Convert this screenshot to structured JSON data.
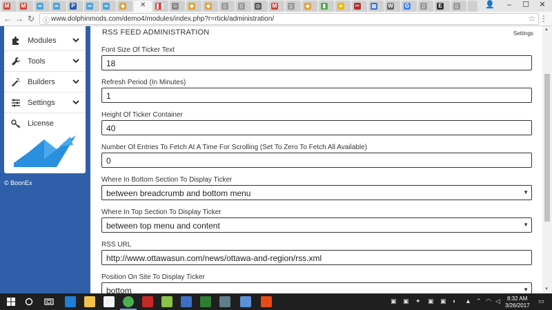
{
  "browser": {
    "url": "www.dolphinmods.com/demo4/modules/index.php?r=rtick/administration/"
  },
  "sidebar": {
    "items": [
      {
        "label": "Modules",
        "icon": "puzzle-icon"
      },
      {
        "label": "Tools",
        "icon": "wrench-icon"
      },
      {
        "label": "Builders",
        "icon": "magic-wand-icon"
      },
      {
        "label": "Settings",
        "icon": "sliders-icon"
      },
      {
        "label": "License",
        "icon": "key-icon"
      }
    ],
    "copyright": "© BoonEx"
  },
  "main": {
    "title": "RSS FEED ADMINISTRATION",
    "settings_link": "Settings",
    "fields": [
      {
        "label": "Font Size Of Ticker Text",
        "value": "18",
        "type": "text"
      },
      {
        "label": "Refresh Period (In Minutes)",
        "value": "1",
        "type": "text"
      },
      {
        "label": "Height Of Ticker Container",
        "value": "40",
        "type": "text"
      },
      {
        "label": "Number Of Entries To Fetch At A Time For Scrolling (Set To Zero To Fetch All Available)",
        "value": "0",
        "type": "text"
      },
      {
        "label": "Where In Bottom Section To Display Ticker",
        "value": "between breadcrumb and bottom menu",
        "type": "select"
      },
      {
        "label": "Where In Top Section To Display Ticker",
        "value": "between top menu and content",
        "type": "select"
      },
      {
        "label": "RSS URL",
        "value": "http://www.ottawasun.com/news/ottawa-and-region/rss.xml",
        "type": "text"
      },
      {
        "label": "Position On Site To Display Ticker",
        "value": "bottom",
        "type": "select"
      }
    ]
  },
  "taskbar": {
    "time": "8:32 AM",
    "date": "3/26/2017"
  },
  "colors": {
    "sidebar_bg": "#2f5fa8",
    "logo_blue": "#2b8fe0"
  }
}
